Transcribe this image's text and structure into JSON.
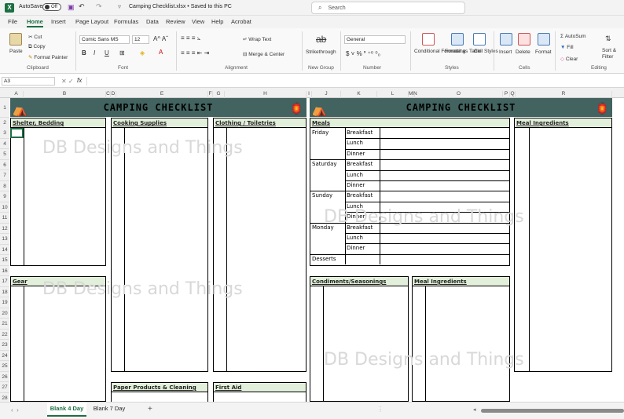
{
  "titlebar": {
    "autosave": "AutoSave",
    "toggle": "Off",
    "filename": "Camping Checklist.xlsx • Saved to this PC",
    "search_placeholder": "Search"
  },
  "tabs": [
    "File",
    "Home",
    "Insert",
    "Page Layout",
    "Formulas",
    "Data",
    "Review",
    "View",
    "Help",
    "Acrobat"
  ],
  "ribbon": {
    "clipboard": {
      "paste": "Paste",
      "cut": "Cut",
      "copy": "Copy",
      "format_painter": "Format Painter",
      "label": "Clipboard"
    },
    "font": {
      "name": "Comic Sans MS",
      "size": "12",
      "label": "Font"
    },
    "alignment": {
      "wrap": "Wrap Text",
      "merge": "Merge & Center",
      "label": "Alignment"
    },
    "newgroup": {
      "strike": "Strikethrough",
      "label": "New Group"
    },
    "number": {
      "format": "General",
      "label": "Number"
    },
    "styles": {
      "cond": "Conditional Formatting",
      "table": "Format as Table",
      "cell": "Cell Styles",
      "label": "Styles"
    },
    "cells": {
      "insert": "Insert",
      "delete": "Delete",
      "format": "Format",
      "label": "Cells"
    },
    "editing": {
      "autosum": "AutoSum",
      "fill": "Fill",
      "clear": "Clear",
      "sort": "Sort & Filter",
      "label": "Editing"
    }
  },
  "formula": {
    "namebox": "A3",
    "fx": "fx"
  },
  "columns": [
    "A",
    "B",
    "C",
    "D",
    "E",
    "F",
    "G",
    "H",
    "I",
    "J",
    "K",
    "L",
    "M",
    "N",
    "O",
    "P",
    "Q",
    "R"
  ],
  "rows": [
    "1",
    "2",
    "3",
    "4",
    "5",
    "6",
    "7",
    "8",
    "9",
    "10",
    "11",
    "12",
    "13",
    "14",
    "15",
    "16",
    "17",
    "18",
    "19",
    "20",
    "21",
    "22",
    "23",
    "24",
    "25",
    "26",
    "27",
    "28"
  ],
  "sheet": {
    "title": "CAMPING CHECKLIST",
    "sections": {
      "shelter": "Shelter, Bedding",
      "cooking": "Cooking Supplies",
      "clothing": "Clothing / Toiletries",
      "meals": "Meals",
      "meal_ing_top": "Meal Ingredients",
      "gear": "Gear",
      "condiments": "Condiments/Seasonings",
      "meal_ing_bottom": "Meal Ingredients",
      "paper": "Paper Products & Cleaning",
      "first_aid": "First Aid"
    },
    "days": [
      "Friday",
      "Saturday",
      "Sunday",
      "Monday"
    ],
    "meals": [
      "Breakfast",
      "Lunch",
      "Dinner"
    ],
    "desserts": "Desserts",
    "watermark": "DB Designs and Things"
  },
  "sheet_tabs": [
    "Blank 4 Day",
    "Blank 7 Day"
  ],
  "colors": {
    "excel_green": "#1d6f42",
    "header_fill": "#e2efda",
    "banner": "#42635f"
  }
}
